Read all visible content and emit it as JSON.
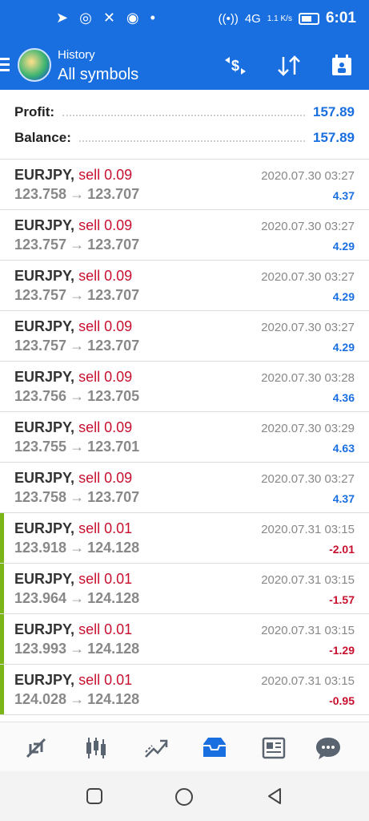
{
  "statusbar": {
    "time": "6:01",
    "net": "4G",
    "speed": "1.1 K/s"
  },
  "appbar": {
    "subtitle": "History",
    "title": "All symbols",
    "icons": [
      "menu-icon",
      "app-logo-icon",
      "currency-swap-icon",
      "sort-icon",
      "calendar-icon"
    ]
  },
  "summary": {
    "profit_label": "Profit:",
    "profit_value": "157.89",
    "balance_label": "Balance:",
    "balance_value": "157.89"
  },
  "trades": [
    {
      "symbol": "EURJPY,",
      "side": "sell 0.09",
      "open": "123.758",
      "close": "123.707",
      "date": "2020.07.30 03:27",
      "profit": "4.37",
      "positive": true,
      "marker": false
    },
    {
      "symbol": "EURJPY,",
      "side": "sell 0.09",
      "open": "123.757",
      "close": "123.707",
      "date": "2020.07.30 03:27",
      "profit": "4.29",
      "positive": true,
      "marker": false
    },
    {
      "symbol": "EURJPY,",
      "side": "sell 0.09",
      "open": "123.757",
      "close": "123.707",
      "date": "2020.07.30 03:27",
      "profit": "4.29",
      "positive": true,
      "marker": false
    },
    {
      "symbol": "EURJPY,",
      "side": "sell 0.09",
      "open": "123.757",
      "close": "123.707",
      "date": "2020.07.30 03:27",
      "profit": "4.29",
      "positive": true,
      "marker": false
    },
    {
      "symbol": "EURJPY,",
      "side": "sell 0.09",
      "open": "123.756",
      "close": "123.705",
      "date": "2020.07.30 03:28",
      "profit": "4.36",
      "positive": true,
      "marker": false
    },
    {
      "symbol": "EURJPY,",
      "side": "sell 0.09",
      "open": "123.755",
      "close": "123.701",
      "date": "2020.07.30 03:29",
      "profit": "4.63",
      "positive": true,
      "marker": false
    },
    {
      "symbol": "EURJPY,",
      "side": "sell 0.09",
      "open": "123.758",
      "close": "123.707",
      "date": "2020.07.30 03:27",
      "profit": "4.37",
      "positive": true,
      "marker": false
    },
    {
      "symbol": "EURJPY,",
      "side": "sell 0.01",
      "open": "123.918",
      "close": "124.128",
      "date": "2020.07.31 03:15",
      "profit": "-2.01",
      "positive": false,
      "marker": true
    },
    {
      "symbol": "EURJPY,",
      "side": "sell 0.01",
      "open": "123.964",
      "close": "124.128",
      "date": "2020.07.31 03:15",
      "profit": "-1.57",
      "positive": false,
      "marker": true
    },
    {
      "symbol": "EURJPY,",
      "side": "sell 0.01",
      "open": "123.993",
      "close": "124.128",
      "date": "2020.07.31 03:15",
      "profit": "-1.29",
      "positive": false,
      "marker": true
    },
    {
      "symbol": "EURJPY,",
      "side": "sell 0.01",
      "open": "124.028",
      "close": "124.128",
      "date": "2020.07.31 03:15",
      "profit": "-0.95",
      "positive": false,
      "marker": true
    }
  ],
  "bottomnav": [
    "quotes-icon",
    "chart-icon",
    "trade-icon",
    "history-icon",
    "news-icon",
    "chat-icon"
  ],
  "colors": {
    "primary": "#1a6fe0",
    "negative": "#c8102e",
    "marker": "#7cb518"
  }
}
